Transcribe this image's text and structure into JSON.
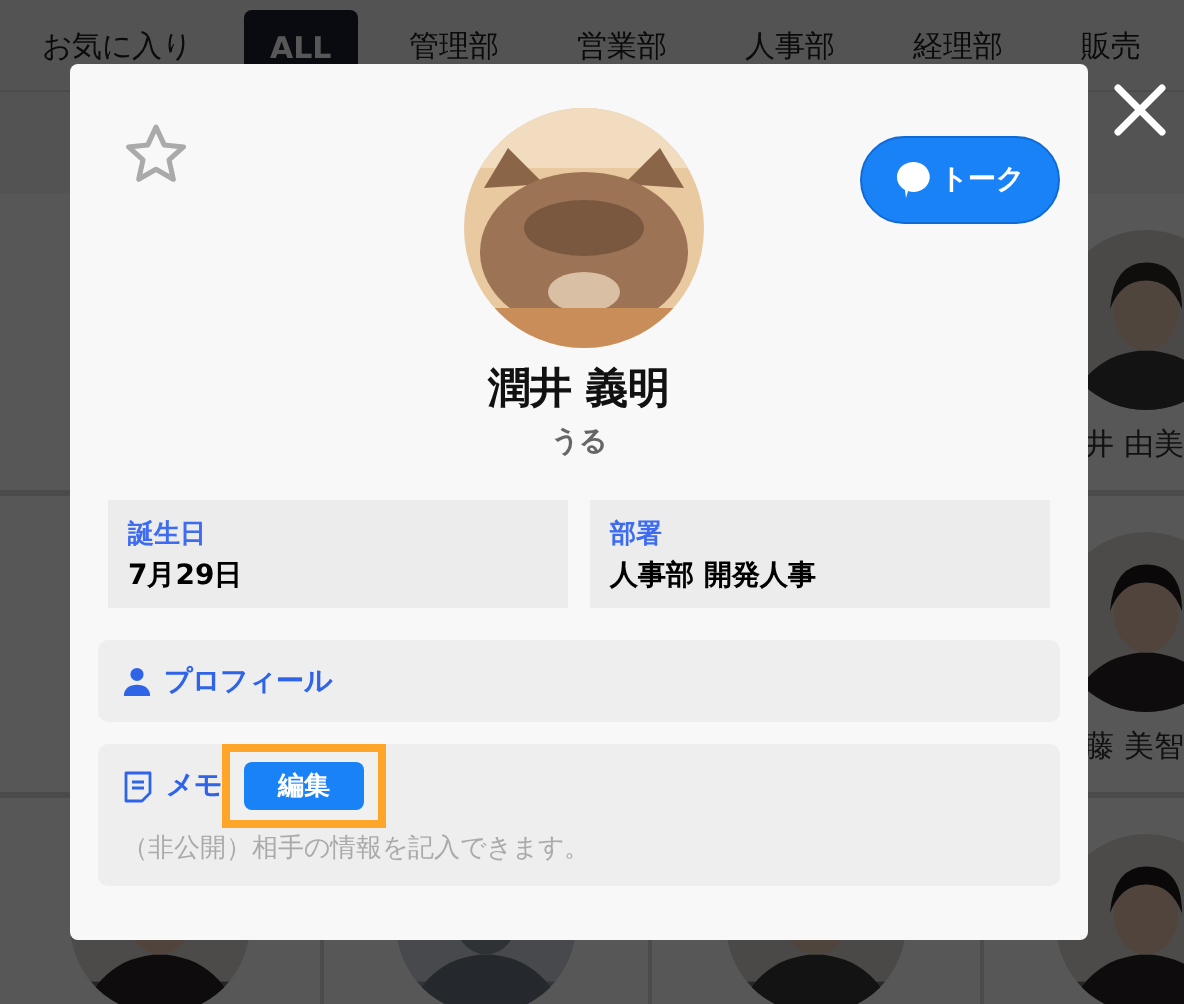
{
  "tabs": [
    {
      "label": "お気に入り",
      "selected": false
    },
    {
      "label": "ALL",
      "selected": true
    },
    {
      "label": "管理部",
      "selected": false
    },
    {
      "label": "営業部",
      "selected": false
    },
    {
      "label": "人事部",
      "selected": false
    },
    {
      "label": "経理部",
      "selected": false
    },
    {
      "label": "販売",
      "selected": false
    }
  ],
  "background_cards": [
    {
      "name": "井 由美"
    },
    {
      "name": "藤 美智"
    }
  ],
  "profile": {
    "favorite": false,
    "talk_button": "トーク",
    "name": "潤井 義明",
    "nickname": "うる",
    "fields": [
      {
        "label": "誕生日",
        "value": "7月29日"
      },
      {
        "label": "部署",
        "value": "人事部 開発人事"
      }
    ],
    "profile_link": "プロフィール",
    "memo": {
      "label": "メモ",
      "edit_button": "編集",
      "edit_highlighted": true,
      "placeholder": "（非公開）相手の情報を記入できます。"
    }
  }
}
